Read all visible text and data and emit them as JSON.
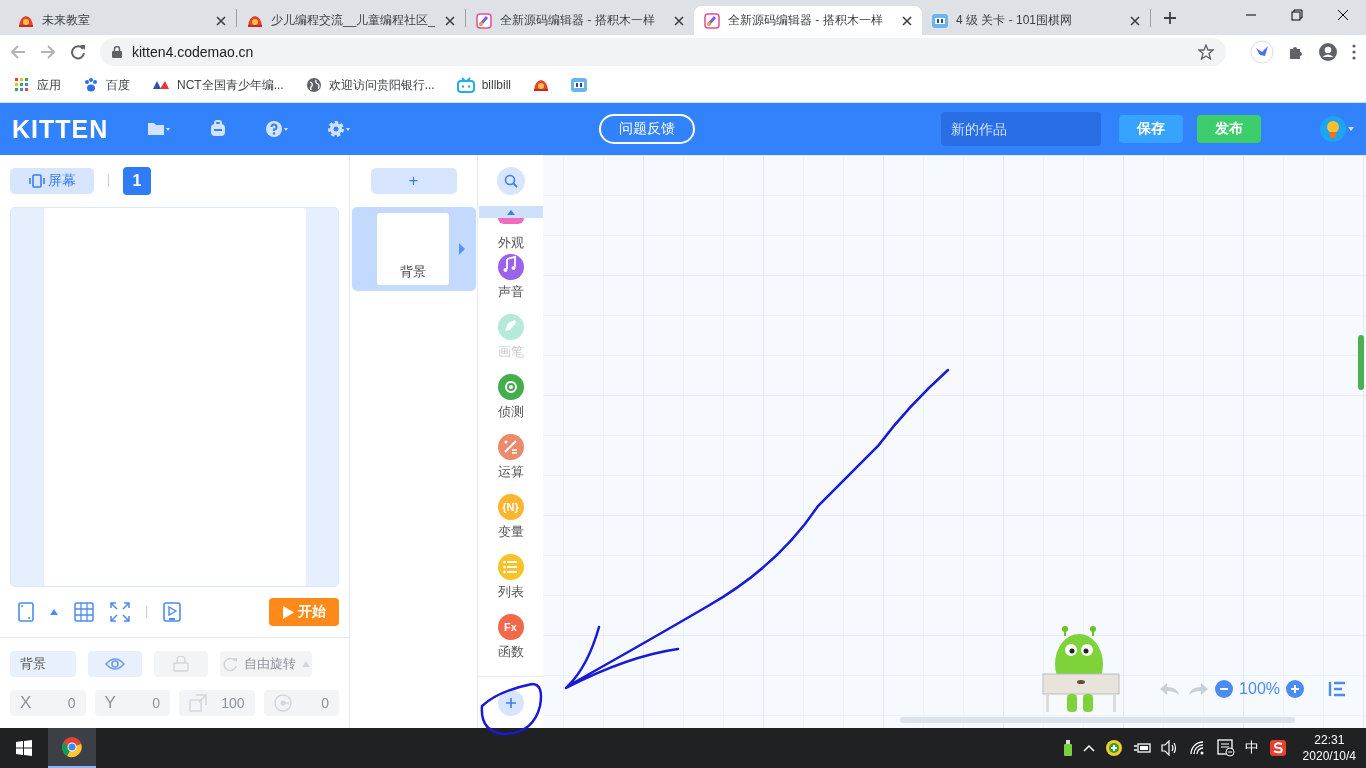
{
  "browser": {
    "tabs": [
      {
        "title": "未来教室",
        "selected": false
      },
      {
        "title": "少儿编程交流__儿童编程社区_",
        "selected": false
      },
      {
        "title": "全新源码编辑器 - 搭积木一样",
        "selected": false
      },
      {
        "title": "全新源码编辑器 - 搭积木一样",
        "selected": true
      },
      {
        "title": "4 级 关卡 - 101围棋网",
        "selected": false
      }
    ],
    "address": "kitten4.codemao.cn",
    "bookmarks": [
      {
        "label": "应用"
      },
      {
        "label": "百度"
      },
      {
        "label": "NCT全国青少年编..."
      },
      {
        "label": "欢迎访问贵阳银行..."
      },
      {
        "label": "billbill"
      }
    ]
  },
  "app": {
    "logo": "KITTEN",
    "feedback": "问题反馈",
    "title_field": {
      "placeholder": "新的作品"
    },
    "save": "保存",
    "publish": "发布"
  },
  "stage": {
    "screen_button": "屏幕",
    "screen_number": "1",
    "start_button": "开始",
    "sprite_name": "背景",
    "visible": true,
    "locked": false,
    "rotation": "自由旋转",
    "props": [
      {
        "label": "X",
        "value": "0"
      },
      {
        "label": "Y",
        "value": "0"
      },
      {
        "value": "100"
      },
      {
        "value": "0"
      }
    ]
  },
  "sprites": {
    "add": "+",
    "items": [
      {
        "name": "背景",
        "selected": true
      }
    ]
  },
  "categories": [
    {
      "label": "外观",
      "color": "#f36bbf",
      "disabled": false
    },
    {
      "label": "声音",
      "color": "#9b62ea",
      "disabled": false
    },
    {
      "label": "画笔",
      "color": "#b5e9da",
      "disabled": true
    },
    {
      "label": "侦测",
      "color": "#45ad4e",
      "disabled": false
    },
    {
      "label": "运算",
      "color": "#eb8b6c",
      "disabled": false
    },
    {
      "label": "变量",
      "badge": "{N}",
      "color": "#fdb42f",
      "disabled": false
    },
    {
      "label": "列表",
      "color": "#f8c328",
      "disabled": false
    },
    {
      "label": "函数",
      "badge": "Fx",
      "color": "#f2684b",
      "disabled": false
    }
  ],
  "workspace": {
    "zoom": "100%"
  },
  "taskbar": {
    "ime": "中",
    "time": "22:31",
    "date": "2020/10/4"
  }
}
